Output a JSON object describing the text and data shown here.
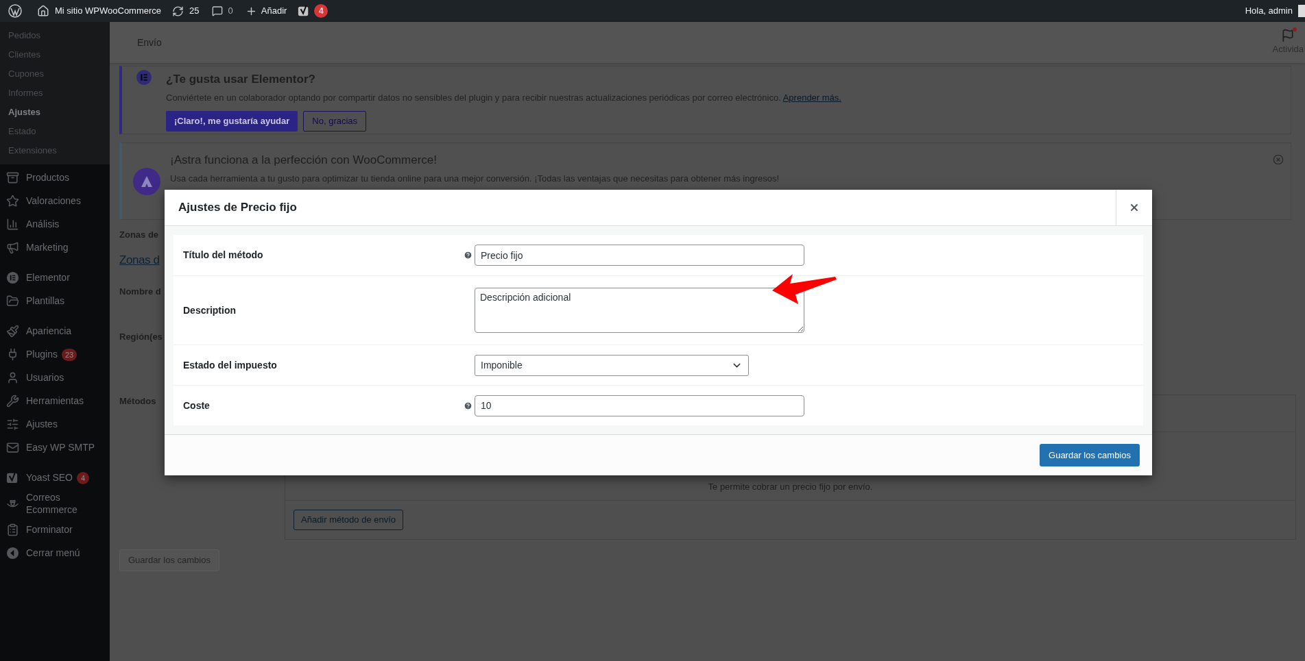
{
  "admin_bar": {
    "site_name": "Mi sitio WPWooCommerce",
    "updates": "25",
    "comments": "0",
    "add_new": "Añadir",
    "yoast_count": "4",
    "greeting": "Hola, admin"
  },
  "sidebar": {
    "submenu": [
      {
        "label": "Pedidos",
        "selected": false
      },
      {
        "label": "Clientes",
        "selected": false
      },
      {
        "label": "Cupones",
        "selected": false
      },
      {
        "label": "Informes",
        "selected": false
      },
      {
        "label": "Ajustes",
        "selected": true
      },
      {
        "label": "Estado",
        "selected": false
      },
      {
        "label": "Extensiones",
        "selected": false
      }
    ],
    "menu_groups": [
      [
        {
          "label": "Productos"
        },
        {
          "label": "Valoraciones"
        },
        {
          "label": "Análisis"
        },
        {
          "label": "Marketing"
        }
      ],
      [
        {
          "label": "Elementor"
        },
        {
          "label": "Plantillas"
        }
      ],
      [
        {
          "label": "Apariencia"
        },
        {
          "label": "Plugins",
          "badge": "23"
        },
        {
          "label": "Usuarios"
        },
        {
          "label": "Herramientas"
        },
        {
          "label": "Ajustes"
        },
        {
          "label": "Easy WP SMTP"
        }
      ],
      [
        {
          "label": "Yoast SEO",
          "badge": "4"
        },
        {
          "label": "Correos Ecommerce"
        },
        {
          "label": "Forminator"
        },
        {
          "label": "Cerrar menú"
        }
      ]
    ]
  },
  "header": {
    "title": "Envío",
    "activity": "Activida"
  },
  "elementor_notice": {
    "title": "¿Te gusta usar Elementor?",
    "text": "Conviértete en un colaborador optando por compartir datos no sensibles del plugin y para recibir nuestras actualizaciones periódicas por correo electrónico.",
    "link": "Aprender más.",
    "buttons": [
      {
        "label": "¡Claro!, me gustaría ayudar",
        "kind": "primary"
      },
      {
        "label": "No, gracias",
        "kind": "secondary"
      }
    ]
  },
  "astra_notice": {
    "title": "¡Astra funciona a la perfección con WooCommerce!",
    "text": "Usa cada herramienta a tu gusto para optimizar tu tienda online para una mejor conversión. ¡Todas las ventajas que necesitas para obtener más ingresos!"
  },
  "zone_page": {
    "breadcrumb": "Zonas de",
    "zones_link": "Zonas d",
    "field_labels": [
      "Nombre d",
      "Región(es",
      "Métodos"
    ],
    "method_description": "Te permite cobrar un precio fijo por envío.",
    "add_method_button": "Añadir método de envío",
    "save_button": {
      "label": "Guardar los cambios",
      "disabled": true
    }
  },
  "modal": {
    "title": "Ajustes de Precio fijo",
    "fields": [
      {
        "label": "Título del método",
        "kind": "text",
        "help": true,
        "value": "Precio fijo"
      },
      {
        "label": "Description",
        "kind": "textarea",
        "help": false,
        "value": "Descripción adicional"
      },
      {
        "label": "Estado del impuesto",
        "kind": "select",
        "help": false,
        "value": "Imponible"
      },
      {
        "label": "Coste",
        "kind": "text",
        "help": true,
        "value": "10"
      }
    ],
    "save_button": {
      "label": "Guardar los cambios",
      "disabled": false
    }
  }
}
